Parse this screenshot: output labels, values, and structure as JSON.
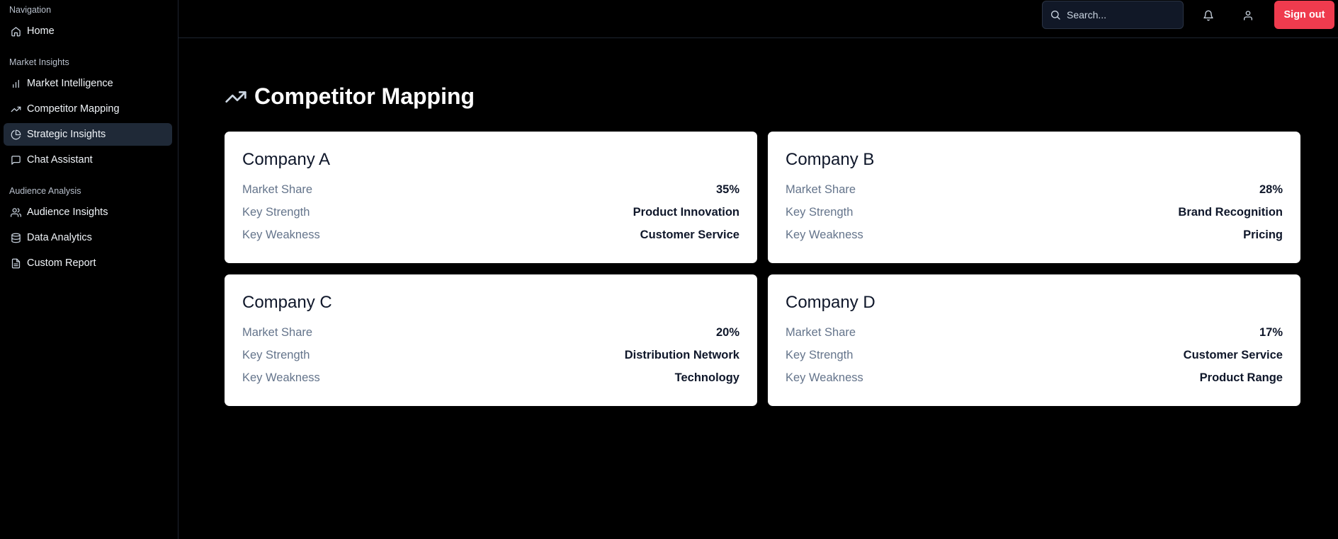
{
  "sidebar": {
    "sections": [
      {
        "title": "Navigation",
        "items": [
          {
            "label": "Home",
            "icon": "home-icon"
          }
        ]
      },
      {
        "title": "Market Insights",
        "items": [
          {
            "label": "Market Intelligence",
            "icon": "bar-chart-icon"
          },
          {
            "label": "Competitor Mapping",
            "icon": "trending-up-icon"
          },
          {
            "label": "Strategic Insights",
            "icon": "pie-chart-icon",
            "active": true
          },
          {
            "label": "Chat Assistant",
            "icon": "message-square-icon"
          }
        ]
      },
      {
        "title": "Audience Analysis",
        "items": [
          {
            "label": "Audience Insights",
            "icon": "users-icon"
          },
          {
            "label": "Data Analytics",
            "icon": "database-icon"
          },
          {
            "label": "Custom Report",
            "icon": "file-text-icon"
          }
        ]
      }
    ]
  },
  "header": {
    "search_placeholder": "Search...",
    "notification_icon": "bell-icon",
    "user_icon": "user-icon",
    "signout_label": "Sign out",
    "signout_color": "#ef3b4e"
  },
  "main": {
    "title": "Competitor Mapping",
    "title_icon": "trending-up-icon",
    "companies": [
      {
        "name": "Company A",
        "rows": [
          {
            "label": "Market Share",
            "value": "35%"
          },
          {
            "label": "Key Strength",
            "value": "Product Innovation"
          },
          {
            "label": "Key Weakness",
            "value": "Customer Service"
          }
        ]
      },
      {
        "name": "Company B",
        "rows": [
          {
            "label": "Market Share",
            "value": "28%"
          },
          {
            "label": "Key Strength",
            "value": "Brand Recognition"
          },
          {
            "label": "Key Weakness",
            "value": "Pricing"
          }
        ]
      },
      {
        "name": "Company C",
        "rows": [
          {
            "label": "Market Share",
            "value": "20%"
          },
          {
            "label": "Key Strength",
            "value": "Distribution Network"
          },
          {
            "label": "Key Weakness",
            "value": "Technology"
          }
        ]
      },
      {
        "name": "Company D",
        "rows": [
          {
            "label": "Market Share",
            "value": "17%"
          },
          {
            "label": "Key Strength",
            "value": "Customer Service"
          },
          {
            "label": "Key Weakness",
            "value": "Product Range"
          }
        ]
      }
    ]
  }
}
